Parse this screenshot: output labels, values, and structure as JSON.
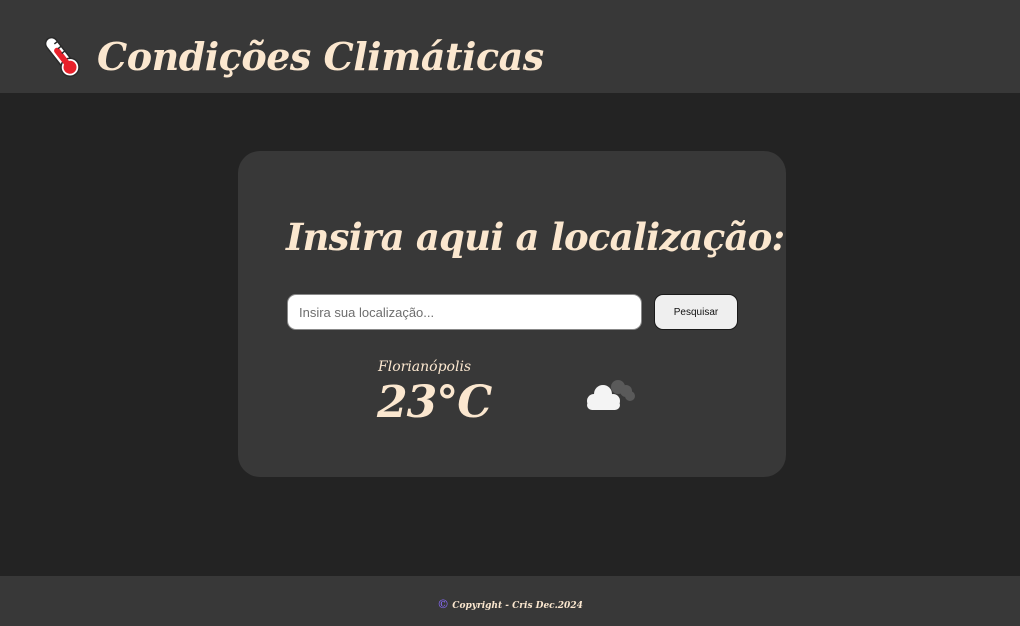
{
  "header": {
    "title": "Condições Climáticas",
    "icon": "thermometer-icon"
  },
  "search": {
    "heading": "Insira aqui a localização:",
    "placeholder": "Insira sua localização...",
    "value": "",
    "button_label": "Pesquisar"
  },
  "weather": {
    "city": "Florianópolis",
    "temperature": "23°C",
    "icon": "cloudy-icon"
  },
  "footer": {
    "symbol": "©",
    "text": "Copyright - Cris Dec.2024"
  },
  "colors": {
    "background": "#232323",
    "panel": "#383838",
    "text_accent": "#fbe7cf",
    "thermometer_red": "#e8202a",
    "copyright_symbol": "#8a6cff"
  }
}
